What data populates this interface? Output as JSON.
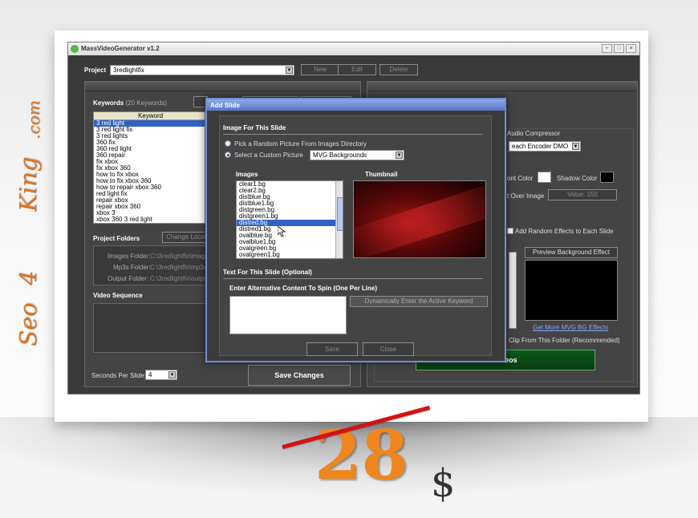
{
  "brand": {
    "text_top": "Seo",
    "text_mid": "4",
    "text_bottom": "King",
    "text_dot": ".com",
    "color": "#e0711c"
  },
  "price": {
    "old": "28",
    "currency": "$",
    "strike_color": "#d31313",
    "price_color": "#f0861e"
  },
  "app": {
    "title": "MassVideoGenerator v1.2",
    "project_label": "Project",
    "project_value": "3redlightfix",
    "buttons": {
      "new": "New",
      "edit": "Edit",
      "delete": "Delete"
    },
    "keywords": {
      "label": "Keywords",
      "count": "(20 Keywords)",
      "column_header": "Keyword",
      "items": [
        "3 red light",
        "3 red light fix",
        "3 red lights",
        "360 fix",
        "360 red light",
        "360 repair",
        "fix xbox",
        "fix xbox 360",
        "how to fix xbox",
        "how to fix xbox 360",
        "how to repair xbox 360",
        "red light fix",
        "repair xbox",
        "repair xbox 360",
        "xbox 3",
        "xbox 360 3 red light"
      ]
    },
    "project_folders": {
      "label": "Project Folders",
      "change_button": "Change Locat",
      "images_label": "Images Folder:",
      "images_value": "C:\\3redlightfix\\images",
      "mp3_label": "Mp3s Folder:",
      "mp3_value": "C:\\3redlightfix\\mp3s",
      "output_label": "Output Folder:",
      "output_value": "C:\\3redlightfix\\output"
    },
    "video_sequence": {
      "label": "Video Sequence"
    },
    "seconds_per_slide": {
      "label": "Seconds Per Slide:",
      "value": "4"
    },
    "save_changes": "Save Changes",
    "right": {
      "audio_compressor_label": "Audio Compressor",
      "audio_compressor_value": "each Encoder DMO",
      "font_color_label": "ont Color",
      "shadow_color_label": "Shadow Color",
      "over_image_label": "t Over Image",
      "value_button": "Value: 150",
      "random_effects_label": "Add Random Effects to Each Slide",
      "preview_button": "Preview Background Effect",
      "more_effects_link": "Get More MVG BG Effects",
      "clip_label": "Clip From This Folder (Recommended)",
      "videos_button": "Videos"
    }
  },
  "dialog": {
    "title": "Add Slide",
    "image_section": "Image For This Slide",
    "option_random": "Pick a Random Picture From Images Directory",
    "option_custom": "Select a Custom Picture",
    "custom_value": "MVG Backgrounds",
    "images_label": "Images",
    "thumbnail_label": "Thumbnail",
    "images": [
      "clear1.bg",
      "clear2.bg",
      "distblue.bg",
      "distblue1.bg",
      "distgreen.bg",
      "distgreen1.bg",
      "distred.bg",
      "distred1.bg",
      "ovalblue.bg",
      "ovalblue1.bg",
      "ovalgreen.bg",
      "ovalgreen1.bg"
    ],
    "selected_image": "distred.bg",
    "text_section": "Text For This Slide (Optional)",
    "alt_content_label": "Enter Alternative Content To Spin (One Per Line)",
    "dyn_button": "Dynamically Enter the Active Keyword",
    "save_button": "Save",
    "close_button": "Close"
  }
}
